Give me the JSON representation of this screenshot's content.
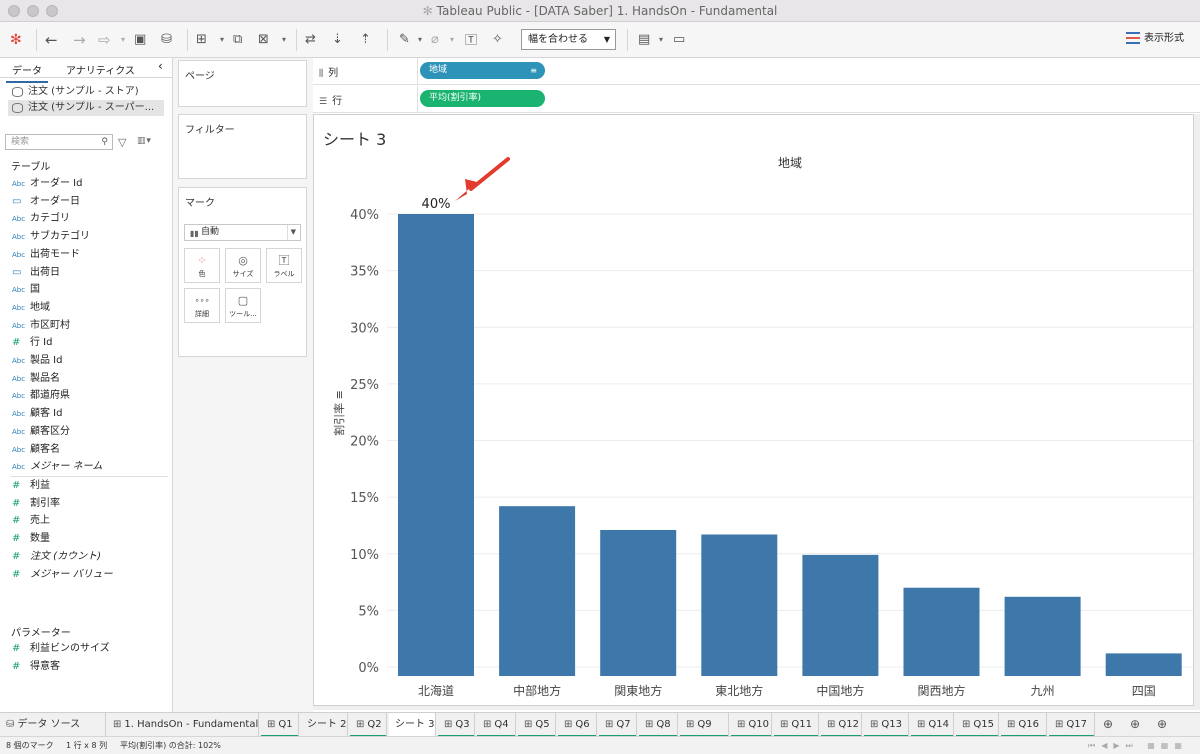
{
  "window": {
    "title": "Tableau Public - [DATA Saber] 1. HandsOn - Fundamental"
  },
  "toolbar": {
    "fit_label": "幅を合わせる",
    "show_me_label": "表示形式"
  },
  "data_pane": {
    "tabs": [
      "データ",
      "アナリティクス"
    ],
    "datasources": [
      "注文 (サンプル - ストア)",
      "注文 (サンプル - スーパー..."
    ],
    "search_placeholder": "検索",
    "tables_header": "テーブル",
    "dimensions": [
      {
        "icon": "Abc",
        "label": "オーダー Id"
      },
      {
        "icon": "cal",
        "label": "オーダー日"
      },
      {
        "icon": "Abc",
        "label": "カテゴリ"
      },
      {
        "icon": "Abc",
        "label": "サブカテゴリ"
      },
      {
        "icon": "Abc",
        "label": "出荷モード"
      },
      {
        "icon": "cal",
        "label": "出荷日"
      },
      {
        "icon": "Abc",
        "label": "国"
      },
      {
        "icon": "Abc",
        "label": "地域"
      },
      {
        "icon": "Abc",
        "label": "市区町村"
      },
      {
        "icon": "#",
        "label": "行 Id"
      },
      {
        "icon": "Abc",
        "label": "製品 Id"
      },
      {
        "icon": "Abc",
        "label": "製品名"
      },
      {
        "icon": "Abc",
        "label": "都道府県"
      },
      {
        "icon": "Abc",
        "label": "顧客 Id"
      },
      {
        "icon": "Abc",
        "label": "顧客区分"
      },
      {
        "icon": "Abc",
        "label": "顧客名"
      },
      {
        "icon": "Abc",
        "label": "メジャー ネーム"
      }
    ],
    "measures": [
      {
        "icon": "#",
        "label": "利益"
      },
      {
        "icon": "#",
        "label": "割引率"
      },
      {
        "icon": "#",
        "label": "売上"
      },
      {
        "icon": "#",
        "label": "数量"
      },
      {
        "icon": "#",
        "label": "注文 (カウント)"
      },
      {
        "icon": "#",
        "label": "メジャー バリュー"
      }
    ],
    "parameters_header": "パラメーター",
    "parameters": [
      {
        "icon": "#",
        "label": "利益ビンのサイズ"
      },
      {
        "icon": "#",
        "label": "得意客"
      }
    ]
  },
  "cards": {
    "pages": "ページ",
    "filters": "フィルター",
    "marks": "マーク",
    "mark_type": "自動",
    "mark_buttons": [
      "色",
      "サイズ",
      "ラベル",
      "詳細",
      "ツール..."
    ]
  },
  "shelves": {
    "columns_label": "列",
    "columns_pill": "地域",
    "rows_label": "行",
    "rows_pill": "平均(割引率)"
  },
  "sheet": {
    "title": "シート 3"
  },
  "chart_data": {
    "type": "bar",
    "title": "",
    "xlabel": "地域",
    "ylabel": "割引率",
    "categories": [
      "北海道",
      "中部地方",
      "関東地方",
      "東北地方",
      "中国地方",
      "関西地方",
      "九州",
      "四国"
    ],
    "values": [
      0.4,
      0.142,
      0.121,
      0.117,
      0.099,
      0.07,
      0.062,
      0.012
    ],
    "yticks": [
      "0%",
      "5%",
      "10%",
      "15%",
      "20%",
      "25%",
      "30%",
      "35%",
      "40%"
    ],
    "ylim": [
      0,
      0.45
    ],
    "data_labels": [
      "40%"
    ],
    "color": "#3e77aa",
    "grid": true
  },
  "tabs": {
    "datasource": "データ ソース",
    "sheets": [
      "1. HandsOn - Fundamental",
      "Q1",
      "シート 2",
      "Q2",
      "シート 3",
      "Q3",
      "Q4",
      "Q5",
      "Q6",
      "Q7",
      "Q8",
      "Q9",
      "Q10",
      "Q11",
      "Q12",
      "Q13",
      "Q14",
      "Q15",
      "Q16",
      "Q17"
    ],
    "active": "シート 3"
  },
  "status": {
    "marks": "8 個のマーク",
    "dims": "1 行 x 8 列",
    "sum": "平均(割引率) の合計: 102%"
  },
  "colors": {
    "accent": "#2f6aa7",
    "bar": "#3e77aa",
    "annotation_arrow": "#e23b2e",
    "dimension_pill": "#2e93b8",
    "measure_pill": "#1ab36f"
  }
}
